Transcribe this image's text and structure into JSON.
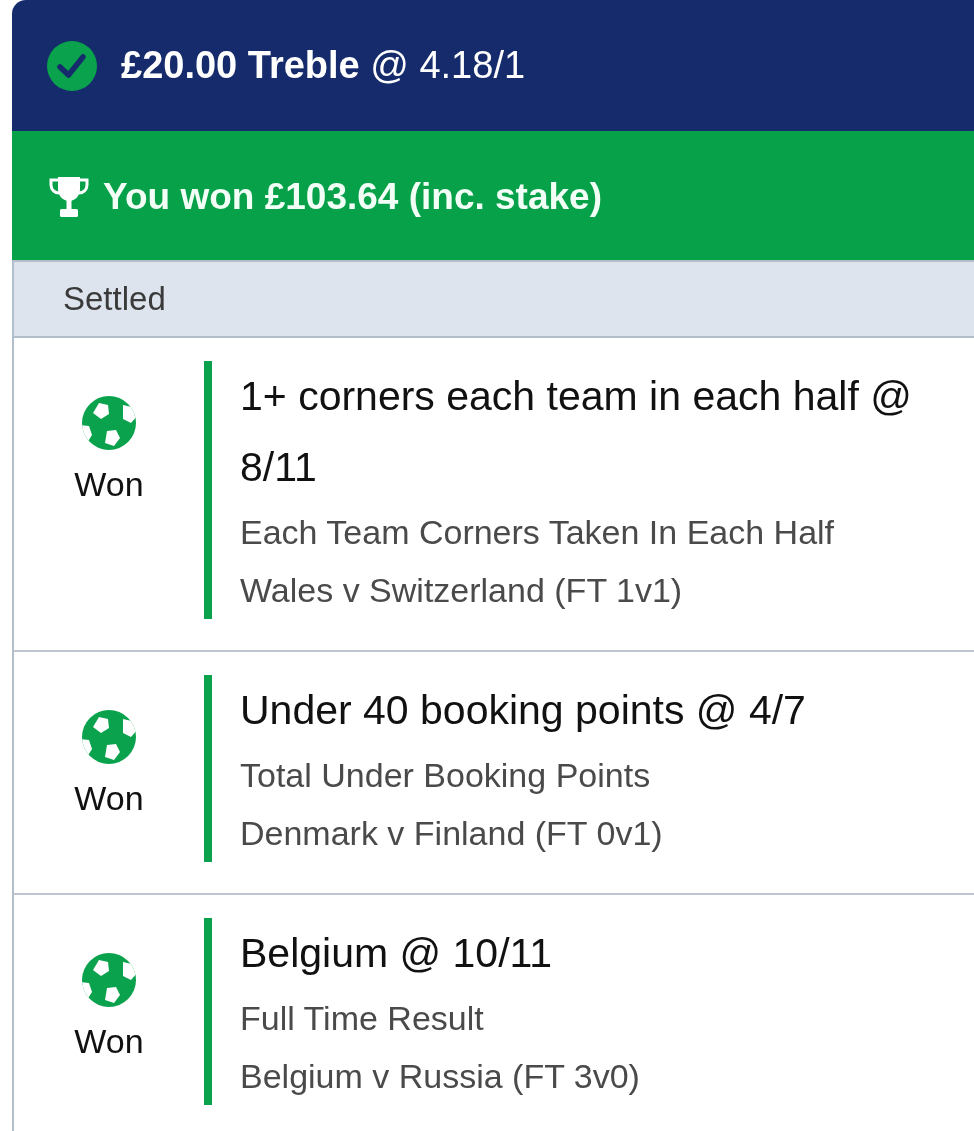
{
  "header": {
    "title": "**£20.00 Treble** @ 4.18/1"
  },
  "banner": {
    "text": "You won £103.64 (inc. stake)"
  },
  "status_label": "Settled",
  "legs": [
    {
      "result": "Won",
      "won": true,
      "selection": "1+ corners each team in each half @ 8/11",
      "market": "Each Team Corners Taken In Each Half",
      "event": "Wales v Switzerland (FT 1v1)"
    },
    {
      "result": "Won",
      "won": true,
      "selection": "Under 40 booking points @ 4/7",
      "market": "Total Under Booking Points",
      "event": "Denmark v Finland (FT 0v1)"
    },
    {
      "result": "Won",
      "won": true,
      "selection": "Belgium @ 10/11",
      "market": "Full Time Result",
      "event": "Belgium v Russia (FT 3v0)"
    }
  ]
}
